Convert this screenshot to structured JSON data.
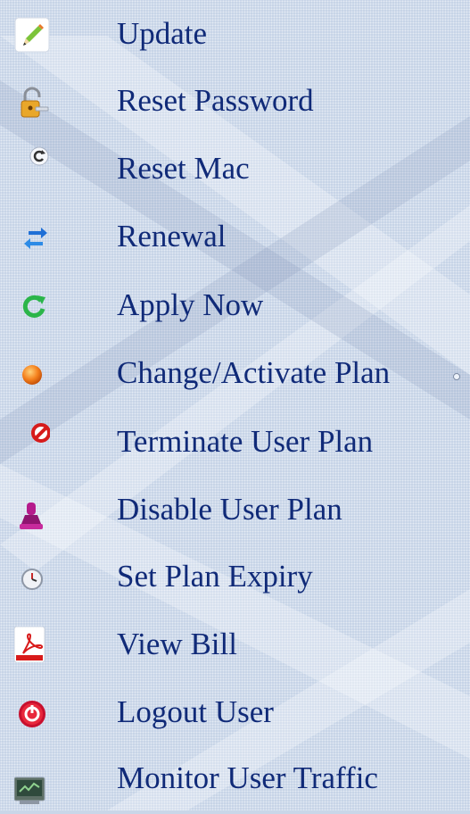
{
  "menu": {
    "items": [
      {
        "label": "Update",
        "icon": "pencil-icon"
      },
      {
        "label": "Reset Password",
        "icon": "lock-key-icon"
      },
      {
        "label": "Reset Mac",
        "icon": "refresh-circle-icon"
      },
      {
        "label": "Renewal",
        "icon": "swap-arrows-icon"
      },
      {
        "label": "Apply Now",
        "icon": "green-cycle-icon"
      },
      {
        "label": "Change/Activate Plan",
        "icon": "orange-ball-icon"
      },
      {
        "label": "Terminate User Plan",
        "icon": "forbidden-icon"
      },
      {
        "label": "Disable User Plan",
        "icon": "stamp-icon"
      },
      {
        "label": "Set Plan Expiry",
        "icon": "clock-icon"
      },
      {
        "label": "View Bill",
        "icon": "pdf-icon"
      },
      {
        "label": "Logout User",
        "icon": "power-icon"
      },
      {
        "label": "Monitor User Traffic",
        "icon": "monitor-icon"
      }
    ]
  },
  "colors": {
    "label_text": "#102a78",
    "background": "#c4d2e6"
  }
}
